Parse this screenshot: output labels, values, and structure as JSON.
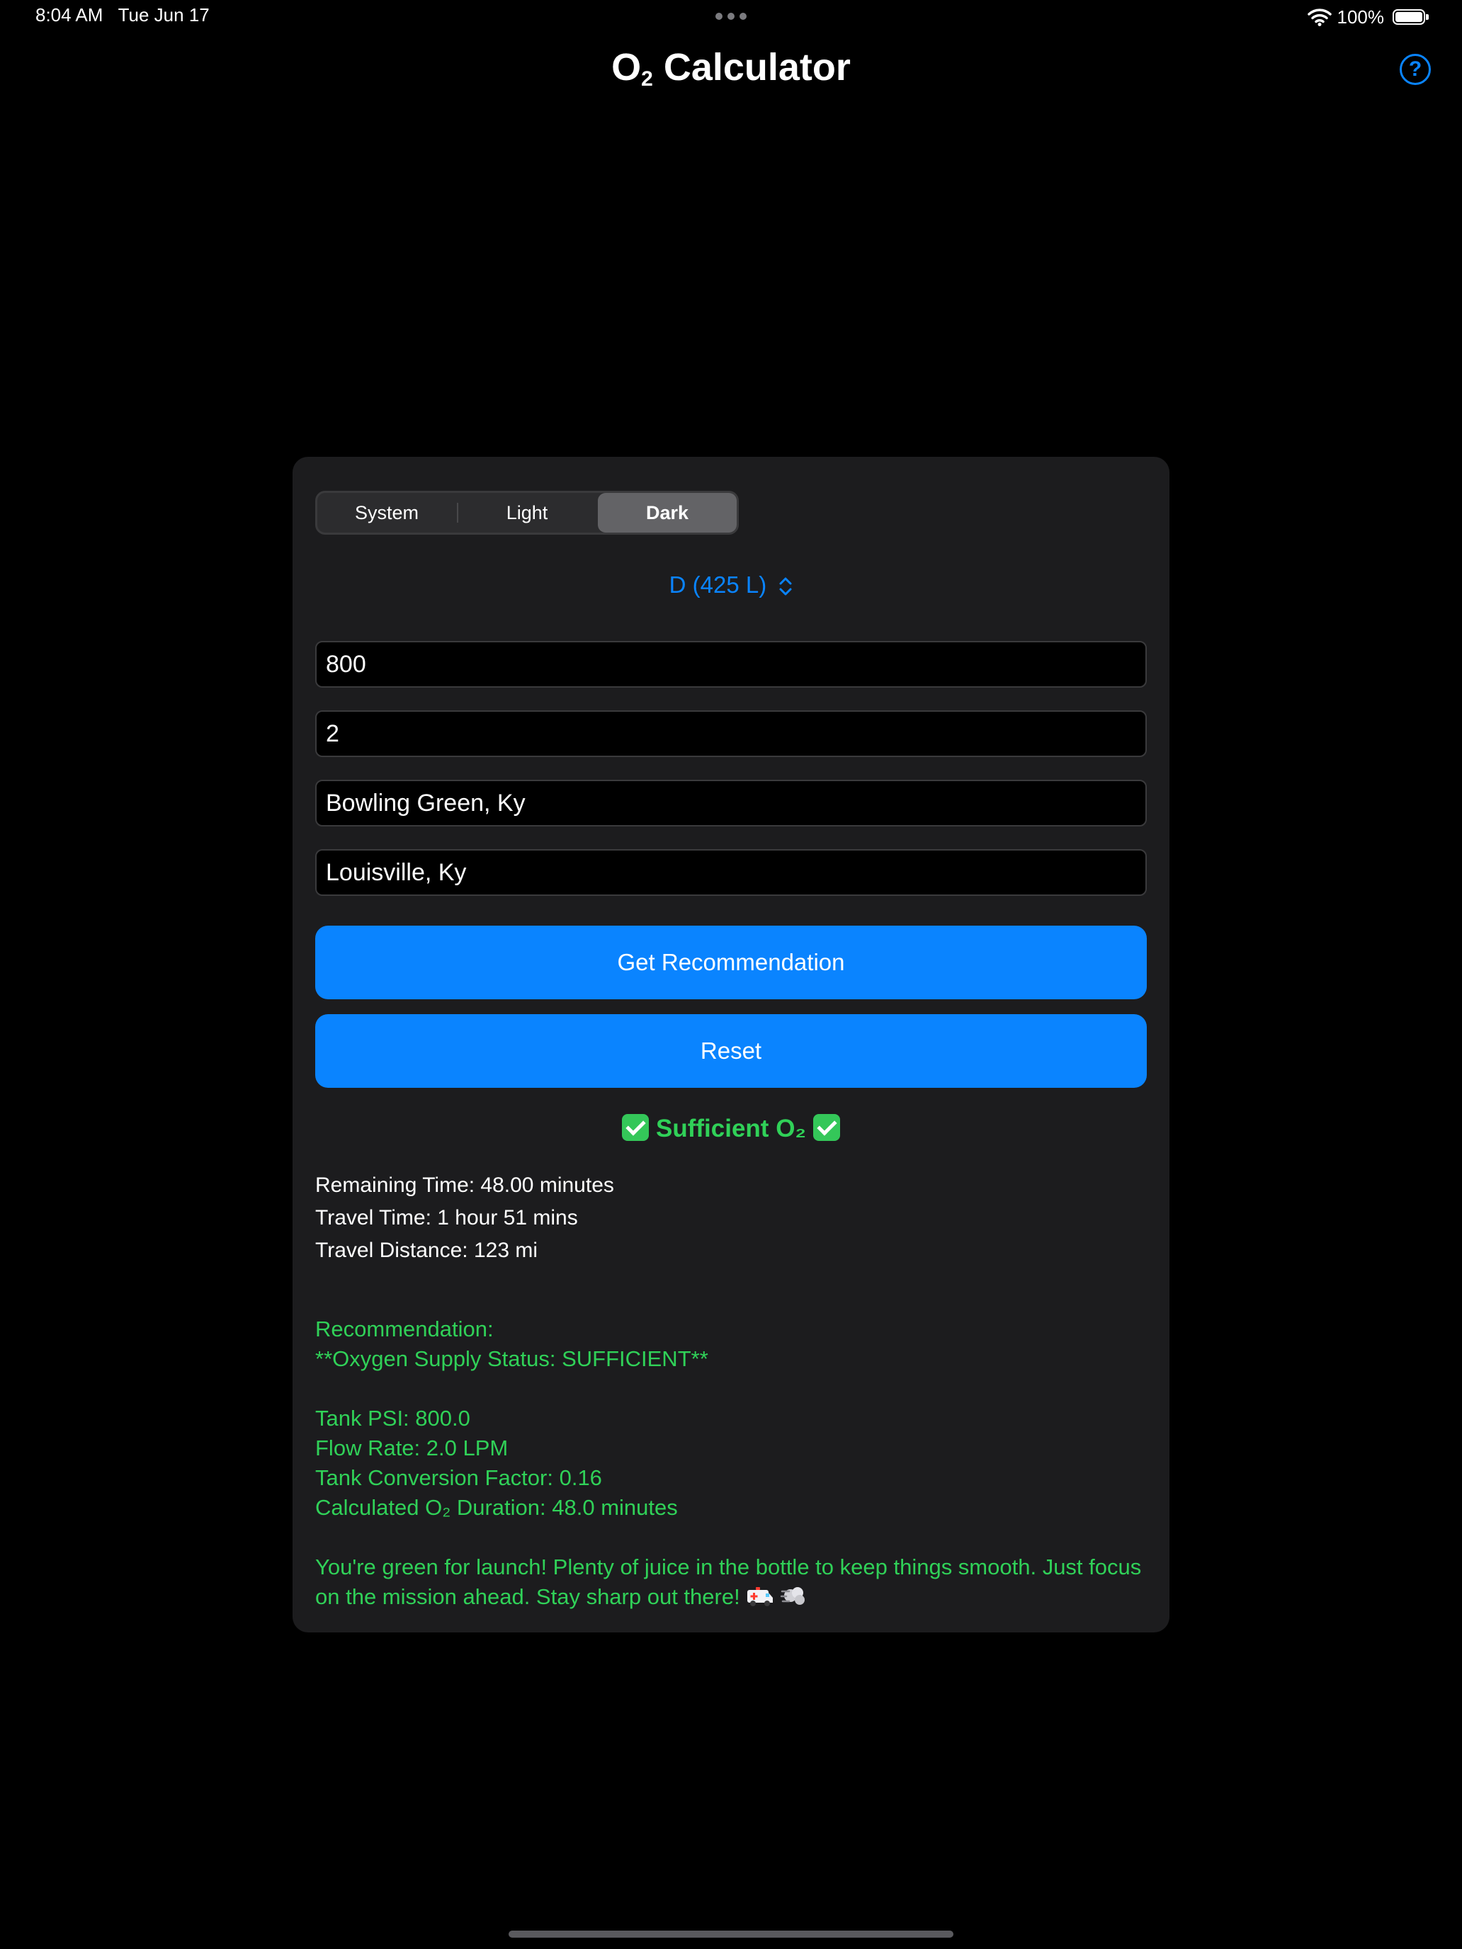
{
  "status_bar": {
    "time": "8:04 AM",
    "date": "Tue Jun 17",
    "battery": "100%"
  },
  "header": {
    "title_prefix": "O",
    "title_sub": "2",
    "title_suffix": " Calculator",
    "help_symbol": "?"
  },
  "appearance": {
    "options": [
      "System",
      "Light",
      "Dark"
    ],
    "selected": "Dark"
  },
  "tank_picker": {
    "label": "D (425 L)"
  },
  "inputs": {
    "psi": "800",
    "flow_rate": "2",
    "origin": "Bowling Green, Ky",
    "destination": "Louisville, Ky"
  },
  "buttons": {
    "recommend": "Get Recommendation",
    "reset": "Reset"
  },
  "result": {
    "status_label": "Sufficient O₂",
    "remaining_time": "Remaining Time: 48.00 minutes",
    "travel_time": "Travel Time: 1 hour 51 mins",
    "travel_distance": "Travel Distance: 123 mi"
  },
  "recommendation": {
    "header": "Recommendation:",
    "status": "**Oxygen Supply Status: SUFFICIENT**",
    "tank_psi": "Tank PSI: 800.0",
    "flow_rate": "Flow Rate: 2.0 LPM",
    "conversion_factor": "Tank Conversion Factor: 0.16",
    "duration": "Calculated O₂ Duration: 48.0 minutes",
    "message": "You're green for launch! Plenty of juice in the bottle to keep things smooth. Just focus on the mission ahead. Stay sharp out there!"
  },
  "icons": {
    "wifi": "wifi-icon",
    "battery": "battery-icon",
    "help": "question-circle-icon",
    "picker": "chevron-up-down-icon",
    "status": "check-mark-icon",
    "emoji_1": "ambulance-icon",
    "emoji_2": "dash-puff-icon"
  },
  "colors": {
    "accent": "#0a84ff",
    "success": "#30d158",
    "card": "#1c1c1e",
    "background": "#000000"
  }
}
